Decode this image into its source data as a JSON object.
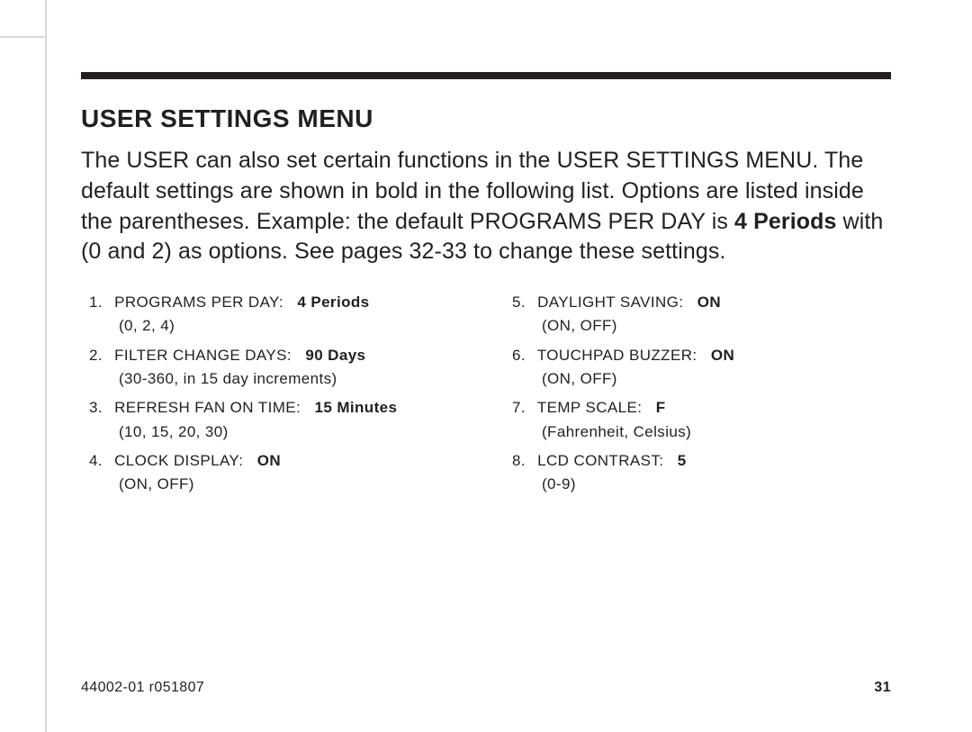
{
  "section_title": "USER SETTINGS MENU",
  "intro": {
    "t1": "The USER can also set certain functions in the USER SETTINGS MENU. The default settings are shown in bold in the following list. Options are listed inside the parentheses. Example: the default PROGRAMS PER DAY is ",
    "bold": "4 Periods",
    "t2": " with (0 and 2) as options. See pages 32-33 to change these settings."
  },
  "settings": [
    {
      "n": "1.",
      "label": "PROGRAMS PER DAY:",
      "default": "4 Periods",
      "options": "(0, 2, 4)"
    },
    {
      "n": "2.",
      "label": "FILTER CHANGE DAYS:",
      "default": "90 Days",
      "options": "(30-360, in 15 day increments)"
    },
    {
      "n": "3.",
      "label": "REFRESH FAN ON TIME:",
      "default": "15 Minutes",
      "options": "(10, 15, 20, 30)"
    },
    {
      "n": "4.",
      "label": "CLOCK DISPLAY:",
      "default": "ON",
      "options": "(ON, OFF)"
    },
    {
      "n": "5.",
      "label": "DAYLIGHT SAVING:",
      "default": "ON",
      "options": "(ON, OFF)"
    },
    {
      "n": "6.",
      "label": "TOUCHPAD BUZZER:",
      "default": "ON",
      "options": "(ON, OFF)"
    },
    {
      "n": "7.",
      "label": "TEMP SCALE:",
      "default": "F",
      "options": "(Fahrenheit, Celsius)"
    },
    {
      "n": "8.",
      "label": "LCD CONTRAST:",
      "default": "5",
      "options": "(0-9)"
    }
  ],
  "footer": {
    "doc_id": "44002-01 r051807",
    "page_number": "31"
  }
}
